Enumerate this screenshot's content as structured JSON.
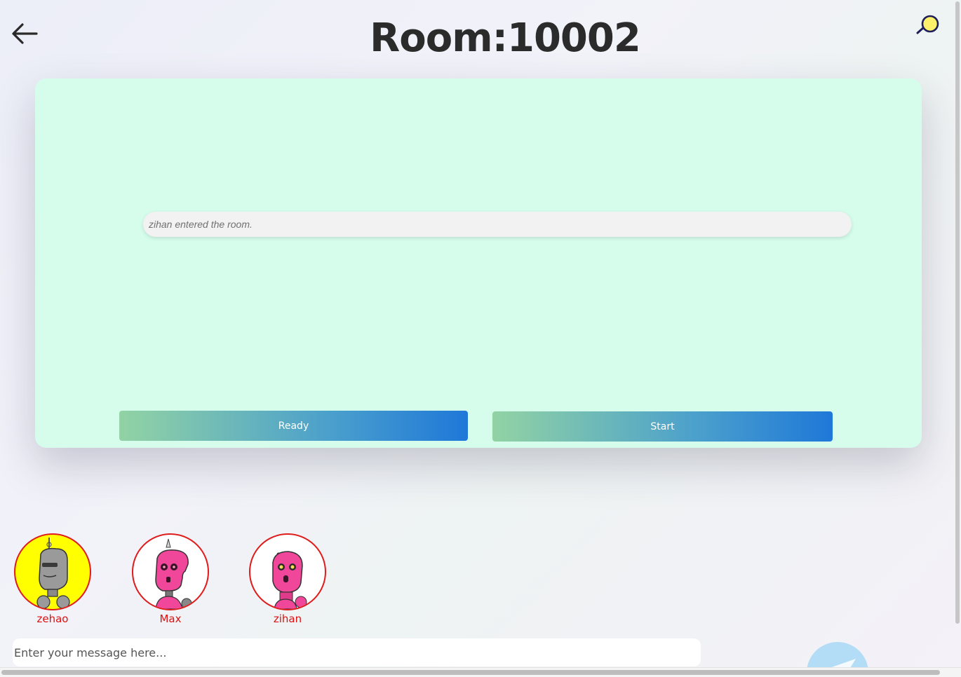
{
  "header": {
    "title": "Room:10002",
    "back_icon": "arrow-left-icon",
    "search_icon": "search-icon"
  },
  "messages": [
    {
      "text": "zihan entered the room."
    }
  ],
  "actions": {
    "ready_label": "Ready",
    "start_label": "Start"
  },
  "players": [
    {
      "name": "zehao",
      "avatar_bg": "#ffff00",
      "robot_color": "#9a9a9a"
    },
    {
      "name": "Max",
      "avatar_bg": "#ffffff",
      "robot_color": "#f0479a"
    },
    {
      "name": "zihan",
      "avatar_bg": "#ffffff",
      "robot_color": "#f0479a"
    }
  ],
  "composer": {
    "placeholder": "Enter your message here...",
    "send_icon": "send-icon"
  },
  "colors": {
    "panel_bg": "#d6fdec",
    "button_gradient_start": "#92d3a4",
    "button_gradient_end": "#1f78d8",
    "player_name": "#e01010",
    "avatar_border": "#e01b1b"
  }
}
